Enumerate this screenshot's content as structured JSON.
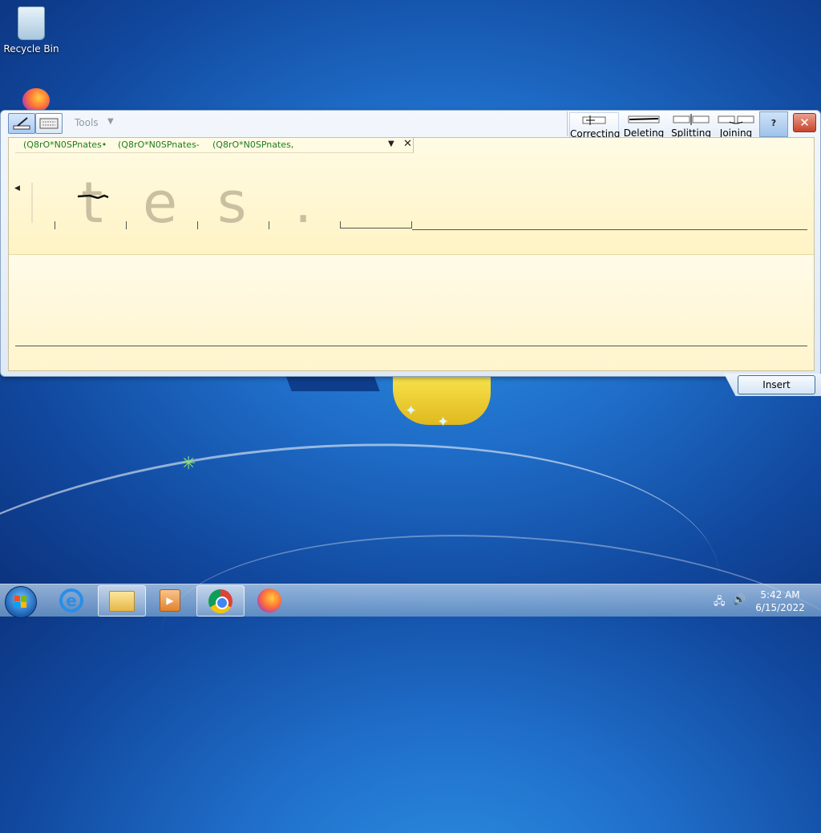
{
  "desktop": {
    "icons": [
      {
        "label": "Recycle Bin",
        "icon": "recycle-bin-icon"
      },
      {
        "label": "",
        "icon": "firefox-icon"
      }
    ]
  },
  "tip": {
    "tools_label": "Tools",
    "gestures": [
      {
        "label": "Correcting",
        "icon": "correcting-gesture-icon"
      },
      {
        "label": "Deleting",
        "icon": "deleting-gesture-icon"
      },
      {
        "label": "Splitting",
        "icon": "splitting-gesture-icon"
      },
      {
        "label": "Joining",
        "icon": "joining-gesture-icon"
      }
    ],
    "help_label": "?",
    "close_label": "✕",
    "alternates": [
      "(Q8rO*N0SPnates•",
      "(Q8rO*N0SPnates-",
      "(Q8rO*N0SPnates,"
    ],
    "recognized_chars": [
      "t",
      "e",
      "s",
      "."
    ],
    "insert_label": "Insert"
  },
  "taskbar": {
    "items": [
      {
        "name": "internet-explorer",
        "icon": "internet-explorer-icon"
      },
      {
        "name": "file-explorer",
        "icon": "folder-icon"
      },
      {
        "name": "media-player",
        "icon": "media-player-icon"
      },
      {
        "name": "chrome",
        "icon": "chrome-icon"
      },
      {
        "name": "firefox",
        "icon": "firefox-icon"
      }
    ],
    "clock": {
      "time": "5:42 AM",
      "date": "6/15/2022"
    }
  }
}
